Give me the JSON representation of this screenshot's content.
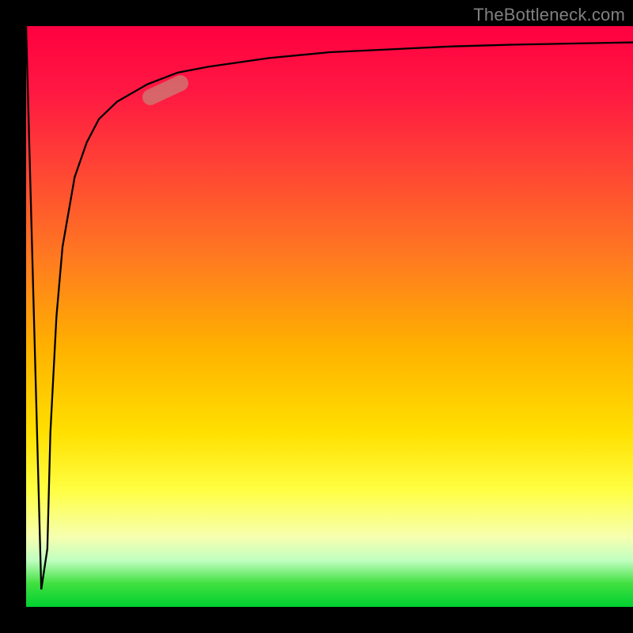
{
  "attribution": "TheBottleneck.com",
  "chart_data": {
    "type": "line",
    "title": "",
    "xlabel": "",
    "ylabel": "",
    "xlim": [
      0,
      100
    ],
    "ylim": [
      0,
      100
    ],
    "grid": false,
    "legend": false,
    "background_gradient": {
      "stops": [
        {
          "pos": 0.0,
          "color": "#ff0040"
        },
        {
          "pos": 0.5,
          "color": "#ffcc00"
        },
        {
          "pos": 0.95,
          "color": "#ffff80"
        },
        {
          "pos": 1.0,
          "color": "#00d030"
        }
      ],
      "direction": "top-to-bottom"
    },
    "series": [
      {
        "name": "bottleneck-curve",
        "x": [
          0,
          2.5,
          3.5,
          4,
          5,
          6,
          8,
          10,
          12,
          15,
          20,
          25,
          30,
          40,
          50,
          60,
          70,
          80,
          90,
          100
        ],
        "y": [
          100,
          3,
          10,
          30,
          50,
          62,
          74,
          80,
          84,
          87,
          90,
          92,
          93,
          94.5,
          95.5,
          96,
          96.5,
          96.8,
          97,
          97.2
        ]
      }
    ],
    "marker": {
      "x": 23,
      "y": 89,
      "angle_deg": -25,
      "color": "#c88278",
      "opacity": 0.72
    },
    "axes_color": "#000000",
    "axes_thickness_px": 33
  }
}
